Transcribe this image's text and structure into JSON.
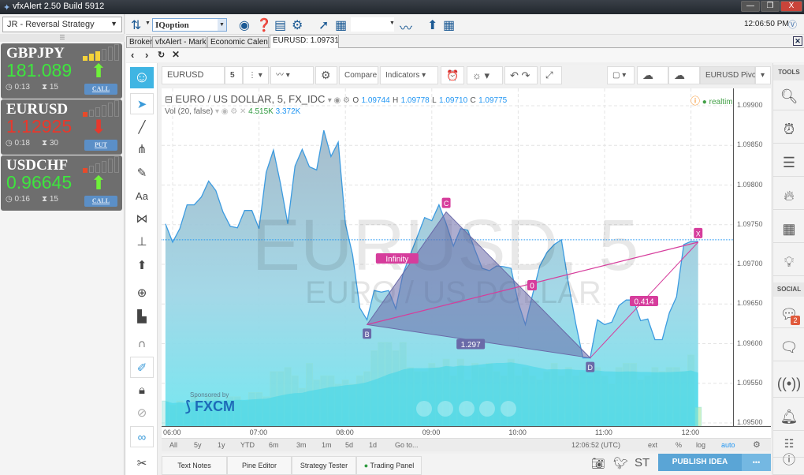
{
  "window": {
    "title": "vfxAlert 2.50 Build 5912",
    "min": "—",
    "max": "❐",
    "close": "X"
  },
  "left": {
    "strategy": "JR - Reversal Strategy",
    "cards": [
      {
        "symbol": "GBPJPY",
        "price": "181.089",
        "direction": "up",
        "color": "#3ee53e",
        "time": "0:13",
        "expiry": "15",
        "action": "CALL",
        "strength": 3
      },
      {
        "symbol": "EURUSD",
        "price": "1.12925",
        "direction": "down",
        "color": "#e8382c",
        "time": "0:18",
        "expiry": "30",
        "action": "PUT",
        "strength": 1
      },
      {
        "symbol": "USDCHF",
        "price": "0.96645",
        "direction": "up",
        "color": "#3ee53e",
        "time": "0:16",
        "expiry": "15",
        "action": "CALL",
        "strength": 1
      }
    ]
  },
  "toolbar": {
    "broker": "IQoption",
    "clock": "12:06:50 PM"
  },
  "tabs": [
    {
      "label": "Broker"
    },
    {
      "label": "vfxAlert - Mark..."
    },
    {
      "label": "Economic Calend..."
    },
    {
      "label": "EURUSD: 1.09731..."
    }
  ],
  "chart_toolbar": {
    "symbol": "EURUSD",
    "interval": "5",
    "compare": "Compare",
    "indicators": "Indicators",
    "template": "EURUSD Pivot"
  },
  "legend": {
    "title": "EURO / US DOLLAR, 5, FX_IDC",
    "o_label": "O",
    "o": "1.09744",
    "h_label": "H",
    "h": "1.09778",
    "l_label": "L",
    "l": "1.09710",
    "c_label": "C",
    "c": "1.09775",
    "vol_label": "Vol (20, false)",
    "vol1": "4.515K",
    "vol2": "3.372K",
    "realtime": "realtime"
  },
  "watermark": {
    "line1": "EURUSD, 5",
    "line2": "EURO / US DOLLAR"
  },
  "sponsor": {
    "label": "Sponsored by",
    "brand": "FXCM"
  },
  "chart_data": {
    "type": "area",
    "title": "EURO / US DOLLAR, 5, FX_IDC",
    "start_time": "05:55",
    "interval_minutes": 5,
    "prices": [
      1.09751,
      1.09728,
      1.09745,
      1.09775,
      1.09775,
      1.09785,
      1.09805,
      1.09793,
      1.09766,
      1.09748,
      1.09746,
      1.09768,
      1.09768,
      1.09745,
      1.09816,
      1.09844,
      1.09801,
      1.09751,
      1.09824,
      1.09845,
      1.09823,
      1.09819,
      1.09869,
      1.09836,
      1.09854,
      1.09751,
      1.09712,
      1.09645,
      1.0963,
      1.09667,
      1.09665,
      1.09667,
      1.09644,
      1.09688,
      1.09712,
      1.09735,
      1.09759,
      1.09755,
      1.09775,
      1.09751,
      1.09723,
      1.09745,
      1.09743,
      1.09718,
      1.09695,
      1.09692,
      1.09698,
      1.09697,
      1.09695,
      1.09652,
      1.09624,
      1.09662,
      1.09698,
      1.09715,
      1.09725,
      1.09731,
      1.09675,
      1.09625,
      1.09582,
      1.09582,
      1.0963,
      1.09624,
      1.09627,
      1.09648,
      1.09655,
      1.09655,
      1.09629,
      1.09631,
      1.09605,
      1.09605,
      1.09639,
      1.09659,
      1.09725,
      1.09729,
      1.09729
    ],
    "volume_k": [
      6,
      5,
      6,
      5,
      7,
      6,
      7,
      7,
      6,
      7,
      7,
      6,
      8,
      8,
      7,
      13,
      13,
      14,
      12,
      9,
      15,
      11,
      12,
      12,
      10,
      11,
      10,
      12,
      13,
      18,
      20,
      20,
      18,
      20,
      14,
      13,
      13,
      15,
      14,
      16,
      12,
      16,
      11,
      15,
      14,
      15,
      13,
      12,
      16,
      12,
      14,
      12,
      11,
      13,
      15,
      12,
      14,
      12,
      13,
      12,
      14,
      12,
      10,
      14,
      15,
      15,
      11,
      12,
      14,
      13,
      14,
      14,
      13,
      17,
      4.5
    ],
    "last_price": 1.09731,
    "y_ticks": [
      "1.09900",
      "1.09850",
      "1.09800",
      "1.09750",
      "1.09700",
      "1.09650",
      "1.09600",
      "1.09550",
      "1.09500"
    ],
    "ylim": [
      1.095,
      1.099
    ],
    "x_ticks": [
      "06:00",
      "07:00",
      "08:00",
      "09:00",
      "10:00",
      "11:00",
      "12:00"
    ],
    "pattern": {
      "points": [
        {
          "label": "B",
          "time": "08:15",
          "price": 1.09624
        },
        {
          "label": "C",
          "time": "09:10",
          "price": 1.09766
        },
        {
          "label": "D",
          "time": "10:50",
          "price": 1.09582
        },
        {
          "label": "X",
          "time": "12:05",
          "price": 1.09728
        }
      ],
      "ratios": {
        "bc": "Infinity",
        "bd": "1.297",
        "o": "0",
        "dx": "0.414"
      }
    }
  },
  "range": {
    "items": [
      "All",
      "5y",
      "1y",
      "YTD",
      "6m",
      "3m",
      "1m",
      "5d",
      "1d",
      "Go to..."
    ],
    "time": "12:06:52 (UTC)",
    "ext": "ext",
    "pct": "%",
    "log": "log",
    "auto": "auto"
  },
  "bottom": {
    "tabs": [
      "Text Notes",
      "Pine Editor",
      "Strategy Tester",
      "Trading Panel"
    ],
    "st": "ST",
    "publish": "PUBLISH IDEA",
    "more": "•••"
  },
  "right": {
    "tools_label": "TOOLS",
    "social_label": "SOCIAL",
    "badge": "2"
  },
  "colors": {
    "line": "#3c9be0",
    "pattern": "#d63d9c",
    "accent": "#2196f3",
    "publish": "#5aa5d6"
  }
}
